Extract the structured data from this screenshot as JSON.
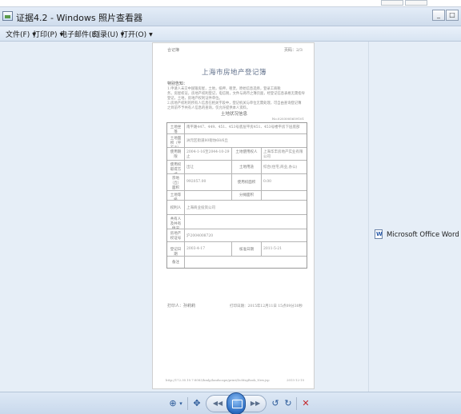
{
  "window": {
    "title": "证据4.2 - Windows 照片查看器",
    "minimize_label": "_",
    "maximize_label": "□"
  },
  "menu": {
    "items": [
      {
        "label": "文件(F)"
      },
      {
        "label": "打印(P)"
      },
      {
        "label": "电子邮件(E)"
      },
      {
        "label": "刻录(U)"
      },
      {
        "label": "打开(O)"
      }
    ]
  },
  "document": {
    "header_left": "合记簿",
    "header_right": "页码：2/3",
    "title": "上海市房地产登记簿",
    "tips_title": "特别告知：",
    "tips_lines": [
      "1.申请人未交中国银房屋，土地，抵押，租赁，原始信息选择，登录工商税",
      "务，房屋权证，房地产权利登记，电信税，文件与两币之簿页面，经登记信息表格无需指导",
      "登记，土地，房地产权利证件单位。",
      "2.房地产权利的所有人信息在相关字段中，登记机关与单位无需处理，可自由查询登记簿",
      "之目前不予共有人信息的查询，仅允许提供本人资料。"
    ],
    "land_heading": "土地状况信息",
    "land_number": "No.0203005659101",
    "rows": [
      {
        "label": "土地坐落",
        "value": "南平路447、449、451、453号底层平房451、453号楼平房下层底部",
        "label2": "",
        "value2": ""
      },
      {
        "label": "土地面积（平方米）",
        "value": "洲元区街道80街坊68/6丘",
        "label2": "",
        "value2": ""
      },
      {
        "label": "使用期限",
        "value": "2004-1-16至2044-10-29 止",
        "label2": "土地使用权人",
        "value2": "上海华丰房地产实业有限公司"
      },
      {
        "label": "使用权取得方式",
        "value": "出让",
        "label2": "土地用途",
        "value2": "综合(住宅,商业,办公)"
      },
      {
        "label": "宗地（丘）面积",
        "value": "992057.00",
        "label2": "使用权面积",
        "value2": "0.00"
      },
      {
        "label": "土地等级",
        "value": "",
        "label2": "分摊面积",
        "value2": ""
      },
      {
        "label": "权利人",
        "value": "上海商业投资公司",
        "label2": "",
        "value2": ""
      },
      {
        "label": "共有人及共有情况",
        "value": "",
        "label2": "",
        "value2": ""
      },
      {
        "label": "房地产权证号",
        "value": "沪2004008720",
        "label2": "",
        "value2": ""
      },
      {
        "label": "登记日期",
        "value": "2003-4-17",
        "label2": "核准日期",
        "value2": "2011-5-21"
      },
      {
        "label": "备注",
        "value": "",
        "label2": "",
        "value2": ""
      }
    ],
    "sign_left": "打印人：孙莉莉",
    "sign_right": "打印日期：2015年12月11日 15点09分30秒",
    "footer_left": "http://172.30.10.7:8083/hmlp/landscape/print/DoMsgBook_New.jsp",
    "footer_right": "2015-12-10"
  },
  "side_panel": {
    "file_label": "Microsoft Office Word 文档"
  },
  "toolbar": {
    "zoom_icon": "⊕",
    "zoom_caret": "▾",
    "fit_icon": "✥",
    "prev_icon": "◀◀",
    "next_icon": "▶▶",
    "rotate_ccw_icon": "↺",
    "rotate_cw_icon": "↻",
    "delete_icon": "✕"
  }
}
